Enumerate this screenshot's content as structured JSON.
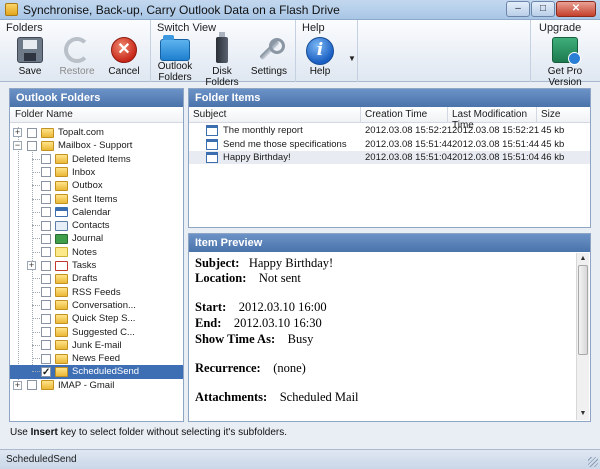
{
  "window": {
    "title": "Synchronise, Back-up, Carry Outlook Data on a Flash Drive"
  },
  "ribbon": {
    "groups": {
      "folders": "Folders",
      "switch_view": "Switch View",
      "help": "Help",
      "upgrade": "Upgrade"
    },
    "save": "Save",
    "restore": "Restore",
    "cancel": "Cancel",
    "outlook_folders": "Outlook Folders",
    "disk_folders": "Disk Folders",
    "settings": "Settings",
    "help_button": "Help",
    "get_pro": "Get Pro Version"
  },
  "outlook_panel": {
    "title": "Outlook Folders",
    "column": "Folder Name",
    "tree": [
      {
        "label": "Topalt.com",
        "icon": "folder"
      },
      {
        "label": "Mailbox - Support",
        "icon": "folder"
      },
      {
        "label": "Deleted Items",
        "icon": "folder"
      },
      {
        "label": "Inbox",
        "icon": "folder"
      },
      {
        "label": "Outbox",
        "icon": "folder"
      },
      {
        "label": "Sent Items",
        "icon": "folder"
      },
      {
        "label": "Calendar",
        "icon": "calendar"
      },
      {
        "label": "Contacts",
        "icon": "contacts"
      },
      {
        "label": "Journal",
        "icon": "journal"
      },
      {
        "label": "Notes",
        "icon": "notes"
      },
      {
        "label": "Tasks",
        "icon": "tasks"
      },
      {
        "label": "Drafts",
        "icon": "folder"
      },
      {
        "label": "RSS Feeds",
        "icon": "folder"
      },
      {
        "label": "Conversation...",
        "icon": "folder"
      },
      {
        "label": "Quick Step S...",
        "icon": "folder"
      },
      {
        "label": "Suggested C...",
        "icon": "folder"
      },
      {
        "label": "Junk E-mail",
        "icon": "folder"
      },
      {
        "label": "News Feed",
        "icon": "folder"
      },
      {
        "label": "ScheduledSend",
        "icon": "folder",
        "checked": true,
        "selected": true
      },
      {
        "label": "IMAP - Gmail",
        "icon": "folder"
      }
    ]
  },
  "folder_items": {
    "title": "Folder Items",
    "columns": [
      "Subject",
      "Creation Time",
      "Last Modification Time",
      "Size"
    ],
    "rows": [
      [
        "The monthly report",
        "2012.03.08 15:52:21",
        "2012.03.08 15:52:21",
        "45 kb"
      ],
      [
        "Send me those specifications",
        "2012.03.08 15:51:44",
        "2012.03.08 15:51:44",
        "45 kb"
      ],
      [
        "Happy Birthday!",
        "2012.03.08 15:51:04",
        "2012.03.08 15:51:04",
        "46 kb"
      ]
    ]
  },
  "preview": {
    "title": "Item Preview",
    "subject_label": "Subject:",
    "subject": "Happy Birthday!",
    "location_label": "Location:",
    "location": "Not sent",
    "start_label": "Start:",
    "start": "2012.03.10 16:00",
    "end_label": "End:",
    "end": "2012.03.10 16:30",
    "show_label": "Show Time As:",
    "show": "Busy",
    "recurrence_label": "Recurrence:",
    "recurrence": "(none)",
    "attachments_label": "Attachments:",
    "attachments": "Scheduled Mail"
  },
  "hint": {
    "pre": "Use ",
    "key": "Insert",
    "post": " key to select folder without selecting it's subfolders."
  },
  "status": {
    "text": "ScheduledSend"
  }
}
